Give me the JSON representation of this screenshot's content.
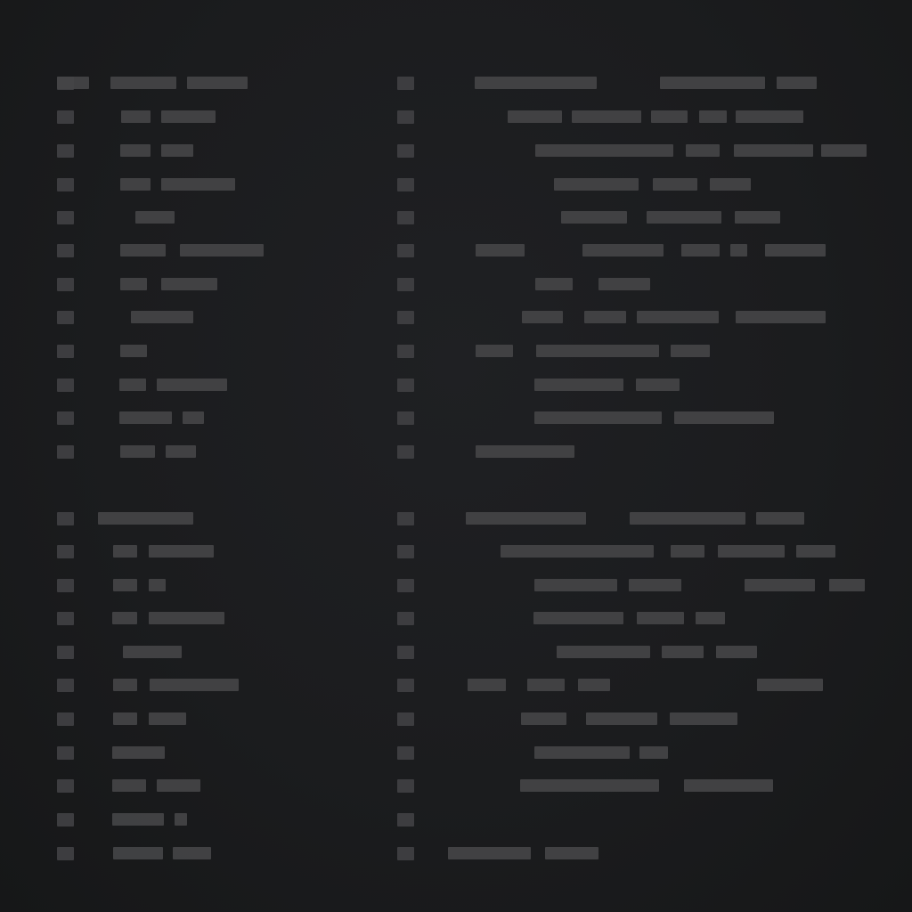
{
  "screen": {
    "description_free": true,
    "visible_text": []
  },
  "colors": {
    "background": "#1b1c1e",
    "placeholder_block": "#444446",
    "row_marker": "#3d3d40"
  },
  "panes": [
    {
      "name": "left-pane",
      "row_groups": [
        12,
        11
      ]
    },
    {
      "name": "right-pane",
      "row_groups": [
        12,
        11
      ]
    }
  ]
}
